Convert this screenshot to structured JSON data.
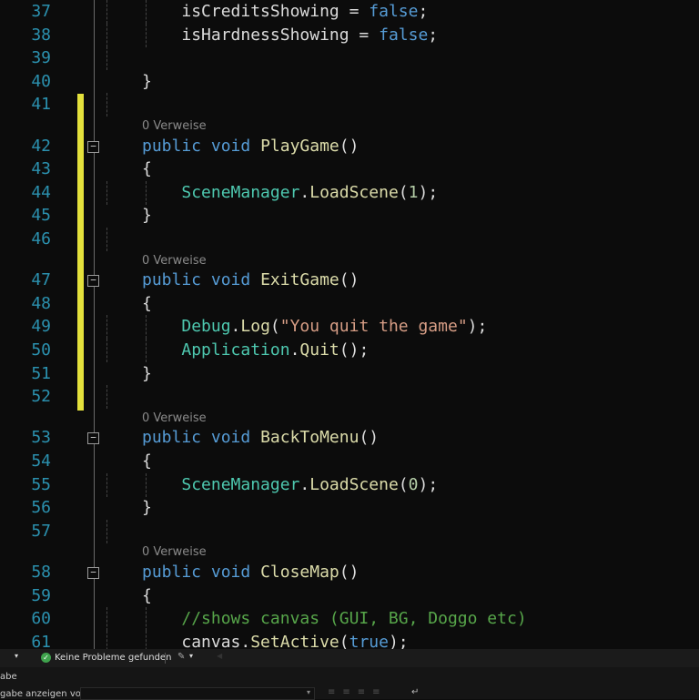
{
  "editor": {
    "codelens_label": "0 Verweise",
    "lines": [
      {
        "n": "37",
        "indent": 2,
        "tokens": [
          [
            "tx",
            "isCreditsShowing = "
          ],
          [
            "kw",
            "false"
          ],
          [
            "tx",
            ";"
          ]
        ]
      },
      {
        "n": "38",
        "indent": 2,
        "tokens": [
          [
            "tx",
            "isHardnessShowing = "
          ],
          [
            "kw",
            "false"
          ],
          [
            "tx",
            ";"
          ]
        ]
      },
      {
        "n": "39",
        "indent": 0,
        "tokens": []
      },
      {
        "n": "40",
        "indent": 1,
        "tokens": [
          [
            "tx",
            "}"
          ]
        ]
      },
      {
        "n": "41",
        "indent": 0,
        "tokens": []
      },
      {
        "n": "42",
        "indent": 1,
        "lens": true,
        "fold": true,
        "tokens": [
          [
            "kw",
            "public"
          ],
          [
            "tx",
            " "
          ],
          [
            "kw",
            "void"
          ],
          [
            "tx",
            " "
          ],
          [
            "mt",
            "PlayGame"
          ],
          [
            "tx",
            "()"
          ]
        ]
      },
      {
        "n": "43",
        "indent": 1,
        "tokens": [
          [
            "tx",
            "{"
          ]
        ]
      },
      {
        "n": "44",
        "indent": 2,
        "tokens": [
          [
            "cl",
            "SceneManager"
          ],
          [
            "tx",
            "."
          ],
          [
            "mt",
            "LoadScene"
          ],
          [
            "tx",
            "("
          ],
          [
            "nm",
            "1"
          ],
          [
            "tx",
            ");"
          ]
        ]
      },
      {
        "n": "45",
        "indent": 1,
        "tokens": [
          [
            "tx",
            "}"
          ]
        ]
      },
      {
        "n": "46",
        "indent": 0,
        "tokens": []
      },
      {
        "n": "47",
        "indent": 1,
        "lens": true,
        "fold": true,
        "tokens": [
          [
            "kw",
            "public"
          ],
          [
            "tx",
            " "
          ],
          [
            "kw",
            "void"
          ],
          [
            "tx",
            " "
          ],
          [
            "mt",
            "ExitGame"
          ],
          [
            "tx",
            "()"
          ]
        ]
      },
      {
        "n": "48",
        "indent": 1,
        "tokens": [
          [
            "tx",
            "{"
          ]
        ]
      },
      {
        "n": "49",
        "indent": 2,
        "tokens": [
          [
            "cl",
            "Debug"
          ],
          [
            "tx",
            "."
          ],
          [
            "mt",
            "Log"
          ],
          [
            "tx",
            "("
          ],
          [
            "st",
            "\"You quit the game\""
          ],
          [
            "tx",
            ");"
          ]
        ]
      },
      {
        "n": "50",
        "indent": 2,
        "tokens": [
          [
            "cl",
            "Application"
          ],
          [
            "tx",
            "."
          ],
          [
            "mt",
            "Quit"
          ],
          [
            "tx",
            "();"
          ]
        ]
      },
      {
        "n": "51",
        "indent": 1,
        "tokens": [
          [
            "tx",
            "}"
          ]
        ]
      },
      {
        "n": "52",
        "indent": 0,
        "tokens": []
      },
      {
        "n": "53",
        "indent": 1,
        "lens": true,
        "fold": true,
        "tokens": [
          [
            "kw",
            "public"
          ],
          [
            "tx",
            " "
          ],
          [
            "kw",
            "void"
          ],
          [
            "tx",
            " "
          ],
          [
            "mt",
            "BackToMenu"
          ],
          [
            "tx",
            "()"
          ]
        ]
      },
      {
        "n": "54",
        "indent": 1,
        "tokens": [
          [
            "tx",
            "{"
          ]
        ]
      },
      {
        "n": "55",
        "indent": 2,
        "tokens": [
          [
            "cl",
            "SceneManager"
          ],
          [
            "tx",
            "."
          ],
          [
            "mt",
            "LoadScene"
          ],
          [
            "tx",
            "("
          ],
          [
            "nm",
            "0"
          ],
          [
            "tx",
            ");"
          ]
        ]
      },
      {
        "n": "56",
        "indent": 1,
        "tokens": [
          [
            "tx",
            "}"
          ]
        ]
      },
      {
        "n": "57",
        "indent": 0,
        "tokens": []
      },
      {
        "n": "58",
        "indent": 1,
        "lens": true,
        "fold": true,
        "tokens": [
          [
            "kw",
            "public"
          ],
          [
            "tx",
            " "
          ],
          [
            "kw",
            "void"
          ],
          [
            "tx",
            " "
          ],
          [
            "mt",
            "CloseMap"
          ],
          [
            "tx",
            "()"
          ]
        ]
      },
      {
        "n": "59",
        "indent": 1,
        "tokens": [
          [
            "tx",
            "{"
          ]
        ]
      },
      {
        "n": "60",
        "indent": 2,
        "tokens": [
          [
            "cm",
            "//shows canvas (GUI, BG, Doggo etc)"
          ]
        ]
      },
      {
        "n": "61",
        "indent": 2,
        "tokens": [
          [
            "tx",
            "canvas."
          ],
          [
            "mt",
            "SetActive"
          ],
          [
            "tx",
            "("
          ],
          [
            "kw",
            "true"
          ],
          [
            "tx",
            ");"
          ]
        ]
      }
    ]
  },
  "statusbar": {
    "problems": "Keine Probleme gefunden",
    "status_icon": "check-circle-icon",
    "brush_icon": "brush-icon"
  },
  "panel": {
    "title": "abe",
    "show_output_label": "gabe anzeigen von:"
  },
  "colors": {
    "change_bar": "#e4e13c",
    "line_number": "#2b91af",
    "keyword": "#569cd6"
  }
}
